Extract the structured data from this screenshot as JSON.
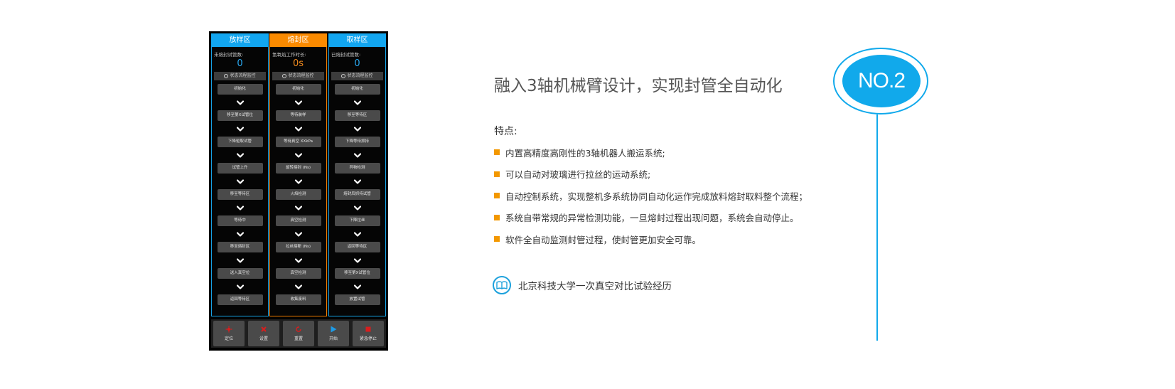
{
  "panel": {
    "columns": [
      {
        "header": "放样区",
        "label": "未熔封试管数:",
        "value": "0",
        "monitor": "状态流程监控",
        "steps": [
          "初始化",
          "移至第X试管位",
          "下降驱取试管",
          "试管上升",
          "移至等待区",
          "等待中",
          "移至熔封区",
          "送入真空位",
          "返回等待区"
        ]
      },
      {
        "header": "熔封区",
        "label": "氢氧焰工作时长:",
        "value": "0s",
        "monitor": "状态流程监控",
        "steps": [
          "初始化",
          "等待装样",
          "等待真空 XXkPa",
          "旋转熔封 (Ns)",
          "火焰检测",
          "真空检测",
          "拉丝熔断 (Ns)",
          "真空检测",
          "收集废料"
        ]
      },
      {
        "header": "取样区",
        "label": "已熔封试管数:",
        "value": "0",
        "monitor": "状态流程监控",
        "steps": [
          "初始化",
          "移至等待区",
          "下降等待抓持",
          "异物检测",
          "熔封后抓持试管",
          "下降拉丝",
          "返回等待区",
          "移至第X试管位",
          "放置试管"
        ]
      }
    ],
    "buttons": [
      {
        "label": "定位",
        "icon": "locate-icon"
      },
      {
        "label": "设置",
        "icon": "settings-icon"
      },
      {
        "label": "重置",
        "icon": "reset-icon"
      },
      {
        "label": "开始",
        "icon": "play-icon"
      },
      {
        "label": "紧急停止",
        "icon": "stop-icon"
      }
    ],
    "colors": {
      "blue": "#12a6f0",
      "orange": "#fa8a00",
      "button_red": "#d81e1e",
      "play_blue": "#1e9be6"
    }
  },
  "content": {
    "title": "融入3轴机械臂设计，实现封管全自动化",
    "features_heading": "特点:",
    "features": [
      "内置高精度高刚性的3轴机器人搬运系统;",
      "可以自动对玻璃进行拉丝的运动系统;",
      "自动控制系统，实现整机多系统协同自动化运作完成放料熔封取料整个流程；",
      "系统自带常规的异常检测功能，一旦熔封过程出现问题，系统会自动停止。",
      "软件全自动监测封管过程，使封管更加安全可靠。"
    ],
    "link_text": "北京科技大学一次真空对比试验经历",
    "link_icon": "book-icon",
    "bullet_color": "#f39800"
  },
  "badge": {
    "text": "NO.2",
    "color": "#11a9eb"
  }
}
